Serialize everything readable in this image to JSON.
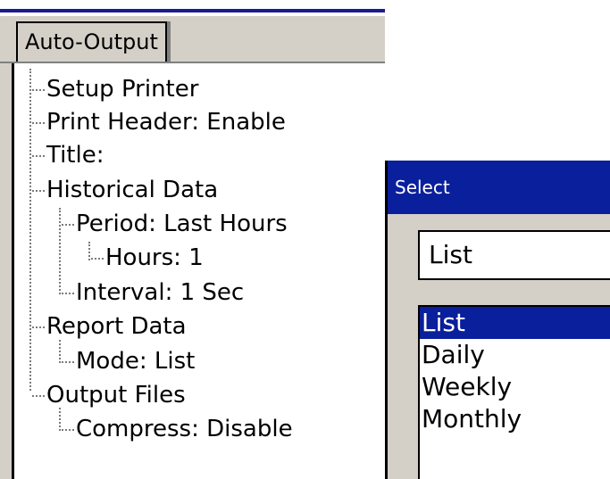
{
  "window": {
    "tab_label": "Auto-Output"
  },
  "tree": {
    "items": [
      {
        "label": "Setup Printer"
      },
      {
        "label": "Print Header: Enable"
      },
      {
        "label": "Title:"
      },
      {
        "label": "Historical Data"
      },
      {
        "label": "Period: Last Hours"
      },
      {
        "label": "Hours: 1"
      },
      {
        "label": "Interval: 1 Sec"
      },
      {
        "label": "Report Data"
      },
      {
        "label": "Mode: List"
      },
      {
        "label": "Output Files"
      },
      {
        "label": "Compress: Disable"
      }
    ]
  },
  "dialog": {
    "title": "Select",
    "current_value": "List",
    "options": [
      "List",
      "Daily",
      "Weekly",
      "Monthly"
    ],
    "selected_index": 0
  },
  "colors": {
    "title_bar": "#0a1f9c",
    "selection": "#0a1f9c",
    "panel": "#d4d0c8"
  }
}
